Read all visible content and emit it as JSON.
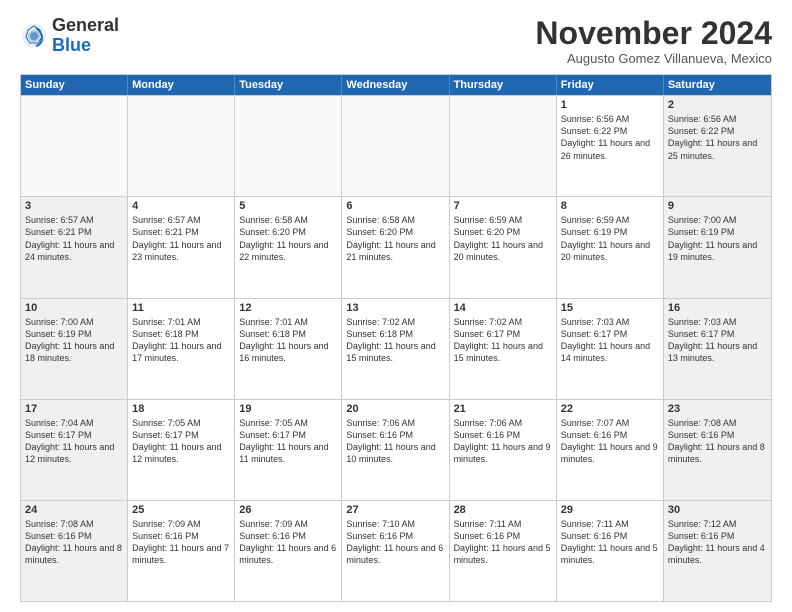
{
  "logo": {
    "general": "General",
    "blue": "Blue"
  },
  "header": {
    "month": "November 2024",
    "location": "Augusto Gomez Villanueva, Mexico"
  },
  "weekdays": [
    "Sunday",
    "Monday",
    "Tuesday",
    "Wednesday",
    "Thursday",
    "Friday",
    "Saturday"
  ],
  "rows": [
    [
      {
        "day": "",
        "empty": true
      },
      {
        "day": "",
        "empty": true
      },
      {
        "day": "",
        "empty": true
      },
      {
        "day": "",
        "empty": true
      },
      {
        "day": "",
        "empty": true
      },
      {
        "day": "1",
        "sunrise": "6:56 AM",
        "sunset": "6:22 PM",
        "daylight": "11 hours and 26 minutes.",
        "weekend": false
      },
      {
        "day": "2",
        "sunrise": "6:56 AM",
        "sunset": "6:22 PM",
        "daylight": "11 hours and 25 minutes.",
        "weekend": true
      }
    ],
    [
      {
        "day": "3",
        "sunrise": "6:57 AM",
        "sunset": "6:21 PM",
        "daylight": "11 hours and 24 minutes.",
        "weekend": true
      },
      {
        "day": "4",
        "sunrise": "6:57 AM",
        "sunset": "6:21 PM",
        "daylight": "11 hours and 23 minutes.",
        "weekend": false
      },
      {
        "day": "5",
        "sunrise": "6:58 AM",
        "sunset": "6:20 PM",
        "daylight": "11 hours and 22 minutes.",
        "weekend": false
      },
      {
        "day": "6",
        "sunrise": "6:58 AM",
        "sunset": "6:20 PM",
        "daylight": "11 hours and 21 minutes.",
        "weekend": false
      },
      {
        "day": "7",
        "sunrise": "6:59 AM",
        "sunset": "6:20 PM",
        "daylight": "11 hours and 20 minutes.",
        "weekend": false
      },
      {
        "day": "8",
        "sunrise": "6:59 AM",
        "sunset": "6:19 PM",
        "daylight": "11 hours and 20 minutes.",
        "weekend": false
      },
      {
        "day": "9",
        "sunrise": "7:00 AM",
        "sunset": "6:19 PM",
        "daylight": "11 hours and 19 minutes.",
        "weekend": true
      }
    ],
    [
      {
        "day": "10",
        "sunrise": "7:00 AM",
        "sunset": "6:19 PM",
        "daylight": "11 hours and 18 minutes.",
        "weekend": true
      },
      {
        "day": "11",
        "sunrise": "7:01 AM",
        "sunset": "6:18 PM",
        "daylight": "11 hours and 17 minutes.",
        "weekend": false
      },
      {
        "day": "12",
        "sunrise": "7:01 AM",
        "sunset": "6:18 PM",
        "daylight": "11 hours and 16 minutes.",
        "weekend": false
      },
      {
        "day": "13",
        "sunrise": "7:02 AM",
        "sunset": "6:18 PM",
        "daylight": "11 hours and 15 minutes.",
        "weekend": false
      },
      {
        "day": "14",
        "sunrise": "7:02 AM",
        "sunset": "6:17 PM",
        "daylight": "11 hours and 15 minutes.",
        "weekend": false
      },
      {
        "day": "15",
        "sunrise": "7:03 AM",
        "sunset": "6:17 PM",
        "daylight": "11 hours and 14 minutes.",
        "weekend": false
      },
      {
        "day": "16",
        "sunrise": "7:03 AM",
        "sunset": "6:17 PM",
        "daylight": "11 hours and 13 minutes.",
        "weekend": true
      }
    ],
    [
      {
        "day": "17",
        "sunrise": "7:04 AM",
        "sunset": "6:17 PM",
        "daylight": "11 hours and 12 minutes.",
        "weekend": true
      },
      {
        "day": "18",
        "sunrise": "7:05 AM",
        "sunset": "6:17 PM",
        "daylight": "11 hours and 12 minutes.",
        "weekend": false
      },
      {
        "day": "19",
        "sunrise": "7:05 AM",
        "sunset": "6:17 PM",
        "daylight": "11 hours and 11 minutes.",
        "weekend": false
      },
      {
        "day": "20",
        "sunrise": "7:06 AM",
        "sunset": "6:16 PM",
        "daylight": "11 hours and 10 minutes.",
        "weekend": false
      },
      {
        "day": "21",
        "sunrise": "7:06 AM",
        "sunset": "6:16 PM",
        "daylight": "11 hours and 9 minutes.",
        "weekend": false
      },
      {
        "day": "22",
        "sunrise": "7:07 AM",
        "sunset": "6:16 PM",
        "daylight": "11 hours and 9 minutes.",
        "weekend": false
      },
      {
        "day": "23",
        "sunrise": "7:08 AM",
        "sunset": "6:16 PM",
        "daylight": "11 hours and 8 minutes.",
        "weekend": true
      }
    ],
    [
      {
        "day": "24",
        "sunrise": "7:08 AM",
        "sunset": "6:16 PM",
        "daylight": "11 hours and 8 minutes.",
        "weekend": true
      },
      {
        "day": "25",
        "sunrise": "7:09 AM",
        "sunset": "6:16 PM",
        "daylight": "11 hours and 7 minutes.",
        "weekend": false
      },
      {
        "day": "26",
        "sunrise": "7:09 AM",
        "sunset": "6:16 PM",
        "daylight": "11 hours and 6 minutes.",
        "weekend": false
      },
      {
        "day": "27",
        "sunrise": "7:10 AM",
        "sunset": "6:16 PM",
        "daylight": "11 hours and 6 minutes.",
        "weekend": false
      },
      {
        "day": "28",
        "sunrise": "7:11 AM",
        "sunset": "6:16 PM",
        "daylight": "11 hours and 5 minutes.",
        "weekend": false
      },
      {
        "day": "29",
        "sunrise": "7:11 AM",
        "sunset": "6:16 PM",
        "daylight": "11 hours and 5 minutes.",
        "weekend": false
      },
      {
        "day": "30",
        "sunrise": "7:12 AM",
        "sunset": "6:16 PM",
        "daylight": "11 hours and 4 minutes.",
        "weekend": true
      }
    ]
  ]
}
